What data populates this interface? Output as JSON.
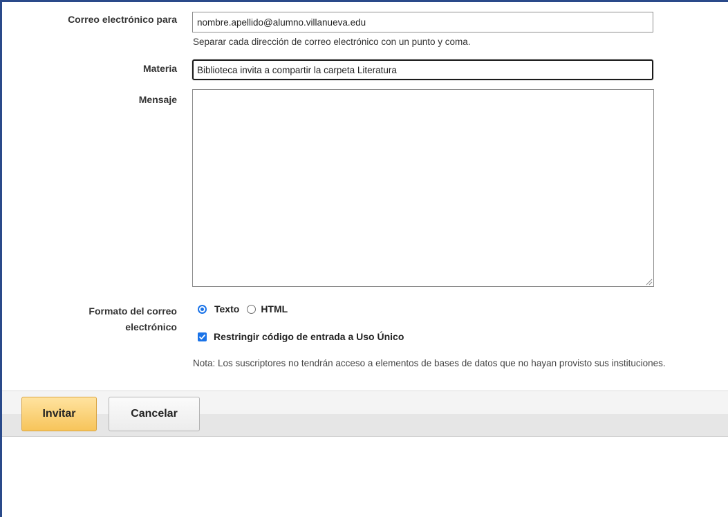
{
  "form": {
    "email_to": {
      "label": "Correo electrónico para",
      "value": "nombre.apellido@alumno.villanueva.edu",
      "hint": "Separar cada dirección de correo electrónico con un punto y coma."
    },
    "subject": {
      "label": "Materia",
      "value": "Biblioteca invita a compartir la carpeta Literatura"
    },
    "message": {
      "label": "Mensaje",
      "value": ""
    },
    "email_format": {
      "label_line1": "Formato del correo",
      "label_line2": "electrónico",
      "options": [
        {
          "label": "Texto",
          "selected": true
        },
        {
          "label": "HTML",
          "selected": false
        }
      ]
    },
    "restrict_code": {
      "label": "Restringir código de entrada a Uso Único",
      "checked": true
    },
    "note": "Nota: Los suscriptores no tendrán acceso a elementos de bases de datos que no hayan provisto sus instituciones."
  },
  "buttons": {
    "invite": "Invitar",
    "cancel": "Cancelar"
  },
  "colors": {
    "frame_border": "#2a4a8a",
    "accent_blue": "#1a73e8",
    "invite_button": "#f7c45a"
  },
  "icons": {
    "checkbox": "checkmark-icon",
    "textarea_resize": "resize-grip-icon"
  }
}
